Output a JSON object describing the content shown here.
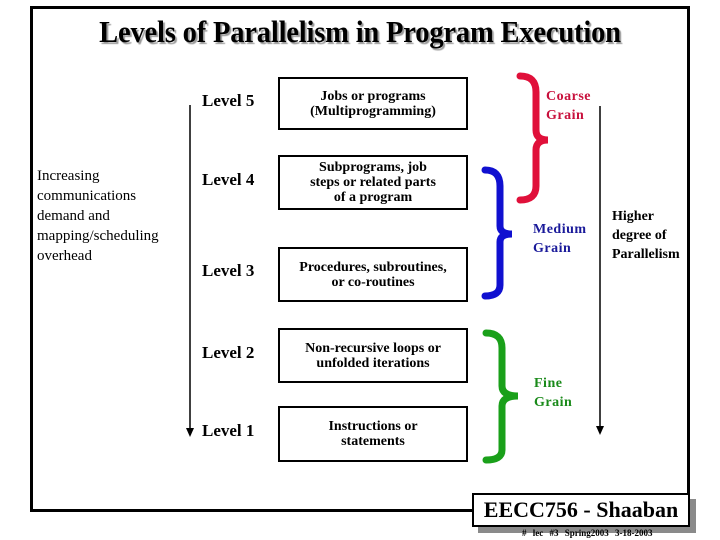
{
  "title": "Levels of Parallelism in Program Execution",
  "left_note": {
    "lines": [
      "Increasing",
      "communications",
      "demand and",
      "mapping/scheduling",
      "overhead"
    ]
  },
  "levels": [
    {
      "label": "Level 5",
      "description": [
        "Jobs or programs",
        "(Multiprogramming)"
      ]
    },
    {
      "label": "Level 4",
      "description": [
        "Subprograms, job",
        "steps or related parts",
        "of a program"
      ]
    },
    {
      "label": "Level 3",
      "description": [
        "Procedures, subroutines,",
        "or co-routines"
      ]
    },
    {
      "label": "Level 2",
      "description": [
        "Non-recursive loops or",
        "unfolded iterations"
      ]
    },
    {
      "label": "Level 1",
      "description": [
        "Instructions or",
        "statements"
      ]
    }
  ],
  "grains": [
    {
      "lines": [
        "Coarse",
        "Grain"
      ],
      "color": "#e0103a"
    },
    {
      "lines": [
        "Medium",
        "Grain"
      ],
      "color": "#1010d0"
    },
    {
      "lines": [
        "Fine",
        "Grain"
      ],
      "color": "#1aa01a"
    }
  ],
  "right_note": {
    "lines": [
      "Higher",
      "degree of",
      "Parallelism"
    ]
  },
  "footer": {
    "course": "EECC756 - Shaaban",
    "meta": "#  lec #3  Spring2003  3-18-2003"
  }
}
